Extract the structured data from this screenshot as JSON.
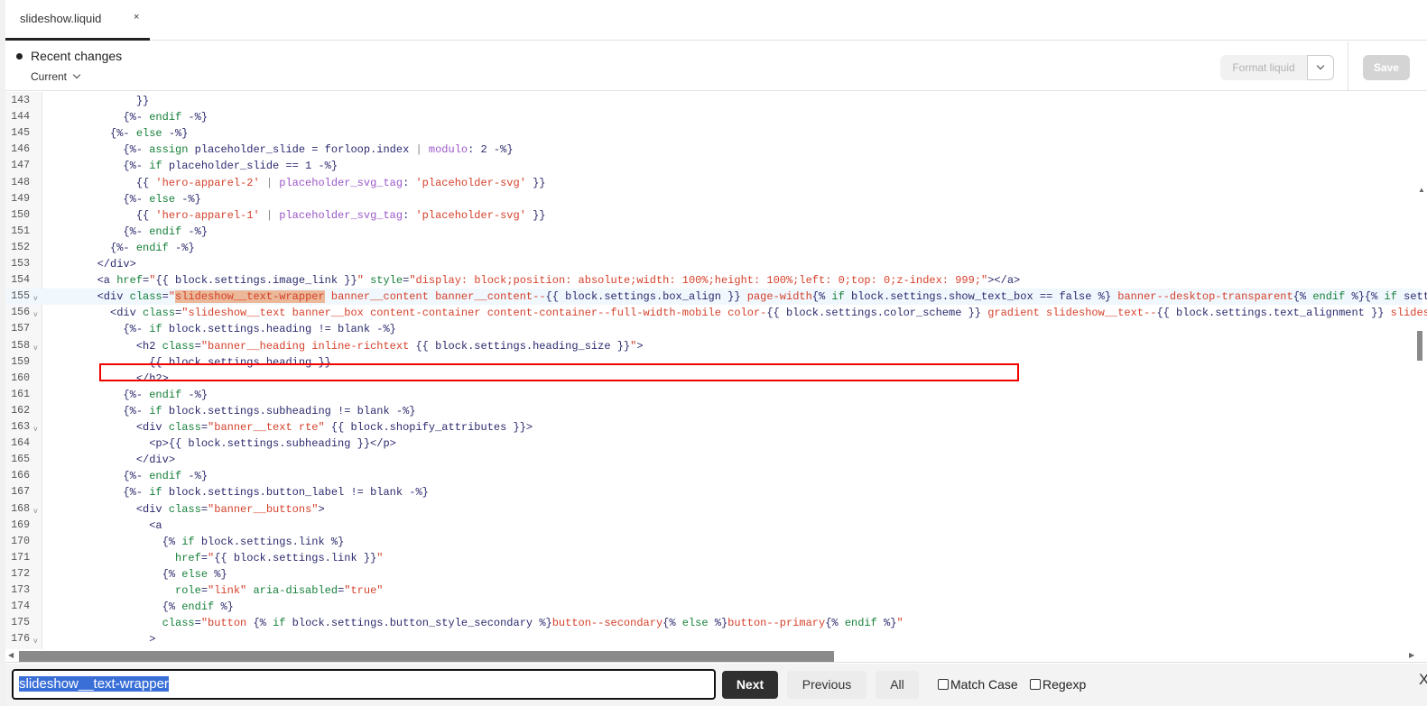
{
  "tab": {
    "label": "slideshow.liquid",
    "close": "×"
  },
  "toolbar": {
    "recent_changes": "Recent changes",
    "version": "Current",
    "format_label": "Format liquid",
    "save_label": "Save"
  },
  "find": {
    "query": "slideshow__text-wrapper",
    "next": "Next",
    "previous": "Previous",
    "all": "All",
    "match_case": "Match Case",
    "regexp": "Regexp",
    "close": "X"
  },
  "code_lines": [
    {
      "n": "143",
      "t": [
        [
          "d",
          "              }}"
        ]
      ]
    },
    {
      "n": "144",
      "t": [
        [
          "d",
          "            {%- "
        ],
        [
          "k",
          "endif"
        ],
        [
          "d",
          " -%}"
        ]
      ]
    },
    {
      "n": "145",
      "t": [
        [
          "d",
          "          {%- "
        ],
        [
          "k",
          "else"
        ],
        [
          "d",
          " -%}"
        ]
      ]
    },
    {
      "n": "146",
      "t": [
        [
          "d",
          "            {%- "
        ],
        [
          "k",
          "assign"
        ],
        [
          "d",
          " placeholder_slide = forloop.index "
        ],
        [
          "o",
          "|"
        ],
        [
          "f",
          " modulo"
        ],
        [
          "d",
          ": 2 -%}"
        ]
      ]
    },
    {
      "n": "147",
      "t": [
        [
          "d",
          "            {%- "
        ],
        [
          "k",
          "if"
        ],
        [
          "d",
          " placeholder_slide == 1 -%}"
        ]
      ]
    },
    {
      "n": "148",
      "t": [
        [
          "d",
          "              {{ "
        ],
        [
          "s",
          "'hero-apparel-2'"
        ],
        [
          "o",
          " |"
        ],
        [
          "f",
          " placeholder_svg_tag"
        ],
        [
          "d",
          ": "
        ],
        [
          "s",
          "'placeholder-svg'"
        ],
        [
          "d",
          " }}"
        ]
      ]
    },
    {
      "n": "149",
      "t": [
        [
          "d",
          "            {%- "
        ],
        [
          "k",
          "else"
        ],
        [
          "d",
          " -%}"
        ]
      ]
    },
    {
      "n": "150",
      "t": [
        [
          "d",
          "              {{ "
        ],
        [
          "s",
          "'hero-apparel-1'"
        ],
        [
          "o",
          " |"
        ],
        [
          "f",
          " placeholder_svg_tag"
        ],
        [
          "d",
          ": "
        ],
        [
          "s",
          "'placeholder-svg'"
        ],
        [
          "d",
          " }}"
        ]
      ]
    },
    {
      "n": "151",
      "t": [
        [
          "d",
          "            {%- "
        ],
        [
          "k",
          "endif"
        ],
        [
          "d",
          " -%}"
        ]
      ]
    },
    {
      "n": "152",
      "t": [
        [
          "d",
          "          {%- "
        ],
        [
          "k",
          "endif"
        ],
        [
          "d",
          " -%}"
        ]
      ]
    },
    {
      "n": "153",
      "t": [
        [
          "d",
          "        </div>"
        ]
      ]
    },
    {
      "n": "154",
      "t": [
        [
          "d",
          "        <a "
        ],
        [
          "k",
          "href"
        ],
        [
          "d",
          "="
        ],
        [
          "s",
          "\""
        ],
        [
          "d",
          "{{ block.settings.image_link }}"
        ],
        [
          "s",
          "\""
        ],
        [
          "k",
          " style"
        ],
        [
          "d",
          "="
        ],
        [
          "s",
          "\"display: block;position: absolute;width: 100%;height: 100%;left: 0;top: 0;z-index: 999;\""
        ],
        [
          "d",
          "></a>"
        ]
      ]
    },
    {
      "n": "155",
      "fold": true,
      "active": true,
      "t": [
        [
          "d",
          "        <div "
        ],
        [
          "k",
          "class"
        ],
        [
          "d",
          "="
        ],
        [
          "s",
          "\""
        ],
        [
          "hl",
          "slideshow__text-wrapper"
        ],
        [
          "s",
          " banner__content banner__content--"
        ],
        [
          "d",
          "{{ block.settings.box_align }}"
        ],
        [
          "s",
          " page-width"
        ],
        [
          "d",
          "{% "
        ],
        [
          "k",
          "if"
        ],
        [
          "d",
          " block.settings.show_text_box == false %}"
        ],
        [
          "s",
          " banner--desktop-transparent"
        ],
        [
          "d",
          "{% "
        ],
        [
          "k",
          "endif"
        ],
        [
          "d",
          " %}{% "
        ],
        [
          "k",
          "if"
        ],
        [
          "d",
          " sett"
        ]
      ]
    },
    {
      "n": "156",
      "fold": true,
      "t": [
        [
          "d",
          "          <div "
        ],
        [
          "k",
          "class"
        ],
        [
          "d",
          "="
        ],
        [
          "s",
          "\"slideshow__text banner__box content-container content-container--full-width-mobile color-"
        ],
        [
          "d",
          "{{ block.settings.color_scheme }}"
        ],
        [
          "s",
          " gradient slideshow__text--"
        ],
        [
          "d",
          "{{ block.settings.text_alignment }}"
        ],
        [
          "s",
          " slides"
        ]
      ]
    },
    {
      "n": "157",
      "t": [
        [
          "d",
          "            {%- "
        ],
        [
          "k",
          "if"
        ],
        [
          "d",
          " block.settings.heading != blank -%}"
        ]
      ]
    },
    {
      "n": "158",
      "fold": true,
      "t": [
        [
          "d",
          "              <h2 "
        ],
        [
          "k",
          "class"
        ],
        [
          "d",
          "="
        ],
        [
          "s",
          "\"banner__heading inline-richtext "
        ],
        [
          "d",
          "{{ block.settings.heading_size }}"
        ],
        [
          "s",
          "\""
        ],
        [
          "d",
          ">"
        ]
      ]
    },
    {
      "n": "159",
      "t": [
        [
          "d",
          "                {{ block.settings.heading }}"
        ]
      ]
    },
    {
      "n": "160",
      "t": [
        [
          "d",
          "              </h2>"
        ]
      ]
    },
    {
      "n": "161",
      "t": [
        [
          "d",
          "            {%- "
        ],
        [
          "k",
          "endif"
        ],
        [
          "d",
          " -%}"
        ]
      ]
    },
    {
      "n": "162",
      "t": [
        [
          "d",
          "            {%- "
        ],
        [
          "k",
          "if"
        ],
        [
          "d",
          " block.settings.subheading != blank -%}"
        ]
      ]
    },
    {
      "n": "163",
      "fold": true,
      "t": [
        [
          "d",
          "              <div "
        ],
        [
          "k",
          "class"
        ],
        [
          "d",
          "="
        ],
        [
          "s",
          "\"banner__text rte\""
        ],
        [
          "d",
          " {{ block.shopify_attributes }}>"
        ]
      ]
    },
    {
      "n": "164",
      "t": [
        [
          "d",
          "                <p>{{ block.settings.subheading }}</p>"
        ]
      ]
    },
    {
      "n": "165",
      "t": [
        [
          "d",
          "              </div>"
        ]
      ]
    },
    {
      "n": "166",
      "t": [
        [
          "d",
          "            {%- "
        ],
        [
          "k",
          "endif"
        ],
        [
          "d",
          " -%}"
        ]
      ]
    },
    {
      "n": "167",
      "t": [
        [
          "d",
          "            {%- "
        ],
        [
          "k",
          "if"
        ],
        [
          "d",
          " block.settings.button_label != blank -%}"
        ]
      ]
    },
    {
      "n": "168",
      "fold": true,
      "t": [
        [
          "d",
          "              <div "
        ],
        [
          "k",
          "class"
        ],
        [
          "d",
          "="
        ],
        [
          "s",
          "\"banner__buttons\""
        ],
        [
          "d",
          ">"
        ]
      ]
    },
    {
      "n": "169",
      "t": [
        [
          "d",
          "                <a"
        ]
      ]
    },
    {
      "n": "170",
      "t": [
        [
          "d",
          "                  {% "
        ],
        [
          "k",
          "if"
        ],
        [
          "d",
          " block.settings.link %}"
        ]
      ]
    },
    {
      "n": "171",
      "t": [
        [
          "k",
          "                    href"
        ],
        [
          "d",
          "="
        ],
        [
          "s",
          "\""
        ],
        [
          "d",
          "{{ block.settings.link }}"
        ],
        [
          "s",
          "\""
        ]
      ]
    },
    {
      "n": "172",
      "t": [
        [
          "d",
          "                  {% "
        ],
        [
          "k",
          "else"
        ],
        [
          "d",
          " %}"
        ]
      ]
    },
    {
      "n": "173",
      "t": [
        [
          "k",
          "                    role"
        ],
        [
          "d",
          "="
        ],
        [
          "s",
          "\"link\""
        ],
        [
          "k",
          " aria-disabled"
        ],
        [
          "d",
          "="
        ],
        [
          "s",
          "\"true\""
        ]
      ]
    },
    {
      "n": "174",
      "t": [
        [
          "d",
          "                  {% "
        ],
        [
          "k",
          "endif"
        ],
        [
          "d",
          " %}"
        ]
      ]
    },
    {
      "n": "175",
      "t": [
        [
          "k",
          "                  class"
        ],
        [
          "d",
          "="
        ],
        [
          "s",
          "\"button "
        ],
        [
          "d",
          "{% "
        ],
        [
          "k",
          "if"
        ],
        [
          "d",
          " block.settings.button_style_secondary %}"
        ],
        [
          "s",
          "button--secondary"
        ],
        [
          "d",
          "{% "
        ],
        [
          "k",
          "else"
        ],
        [
          "d",
          " %}"
        ],
        [
          "s",
          "button--primary"
        ],
        [
          "d",
          "{% "
        ],
        [
          "k",
          "endif"
        ],
        [
          "d",
          " %}"
        ],
        [
          "s",
          "\""
        ]
      ]
    },
    {
      "n": "176",
      "fold": true,
      "t": [
        [
          "d",
          "                >"
        ]
      ]
    }
  ]
}
